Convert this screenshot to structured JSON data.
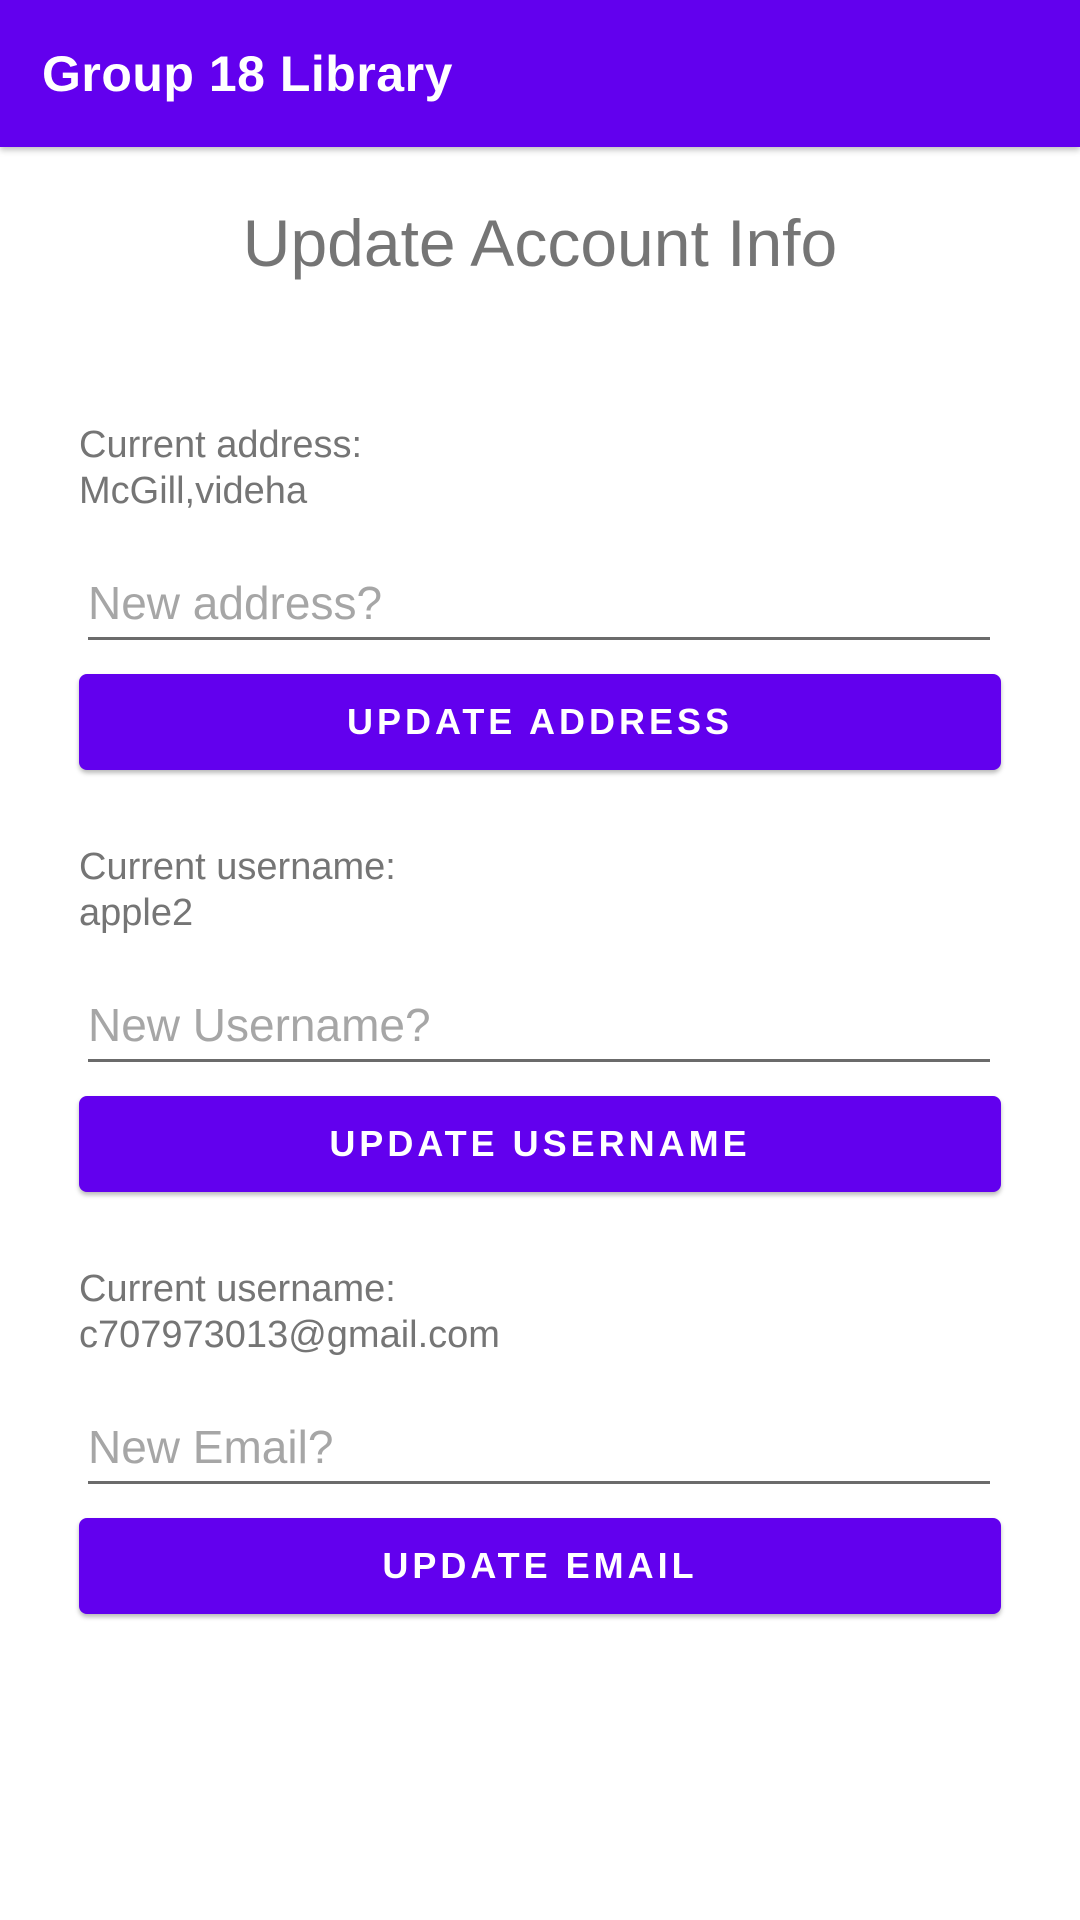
{
  "app_bar": {
    "title": "Group 18 Library"
  },
  "page": {
    "title": "Update Account Info"
  },
  "sections": [
    {
      "current_label": "Current address:",
      "current_value": "McGill,videha",
      "input_placeholder": "New address?",
      "input_value": "",
      "button_label": "UPDATE ADDRESS"
    },
    {
      "current_label": "Current username:",
      "current_value": "apple2",
      "input_placeholder": "New Username?",
      "input_value": "",
      "button_label": "UPDATE USERNAME"
    },
    {
      "current_label": "Current username:",
      "current_value": "c707973013@gmail.com",
      "input_placeholder": "New Email?",
      "input_value": "",
      "button_label": "UPDATE EMAIL"
    }
  ],
  "colors": {
    "primary": "#6200EE",
    "text_secondary": "#757575",
    "hint": "#A6A6A6"
  }
}
